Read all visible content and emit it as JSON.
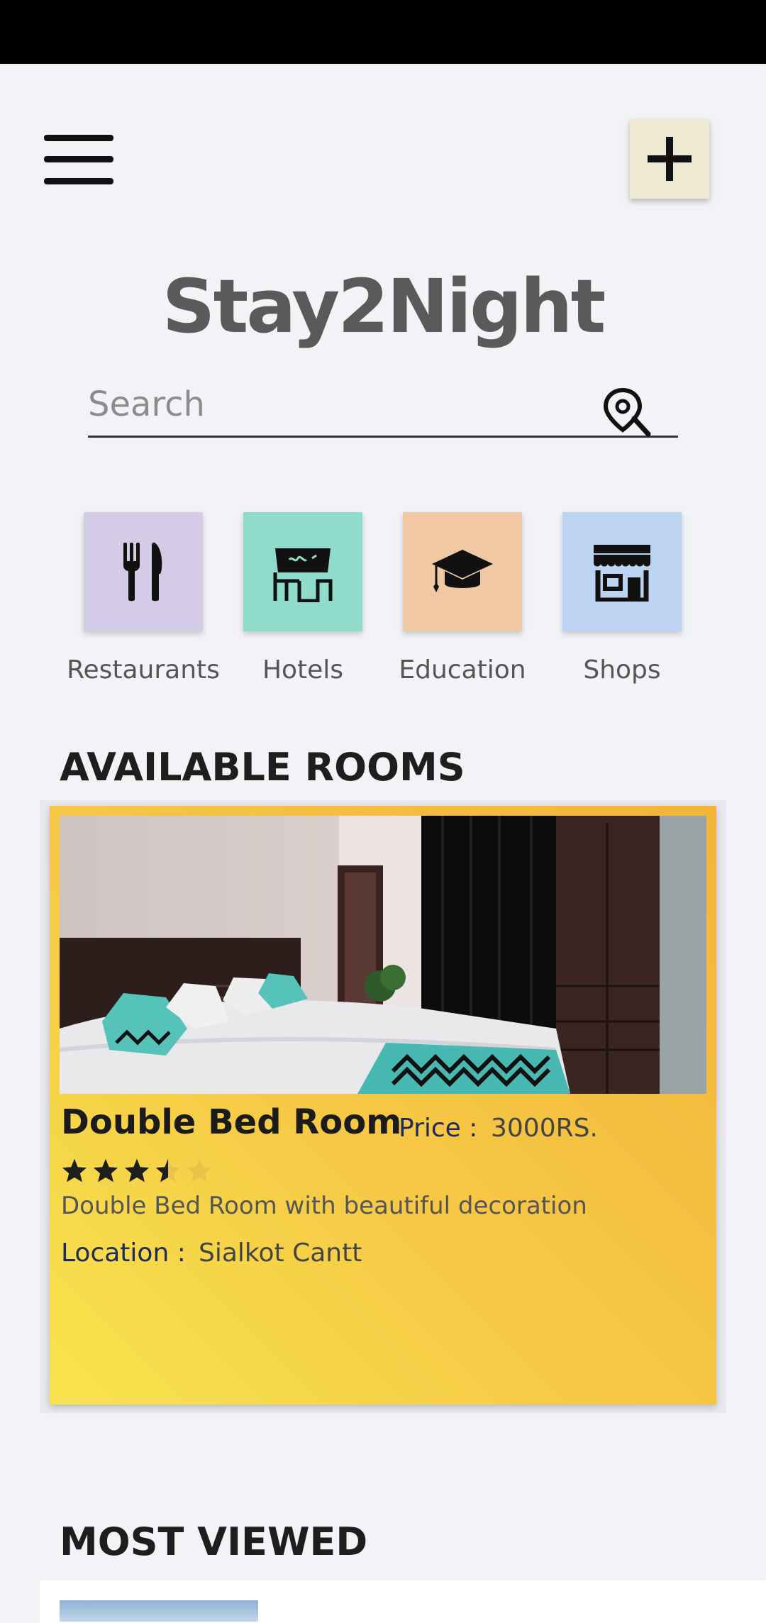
{
  "header": {
    "menu_icon": "hamburger-menu-icon",
    "add_icon": "plus-icon"
  },
  "app": {
    "title": "Stay2Night"
  },
  "search": {
    "placeholder": "Search",
    "icon": "location-search-icon"
  },
  "categories": [
    {
      "label": "Restaurants",
      "icon": "fork-knife-icon",
      "color": "#d4cce6"
    },
    {
      "label": "Hotels",
      "icon": "hotel-sign-icon",
      "color": "#8fdccd"
    },
    {
      "label": "Education",
      "icon": "graduation-cap-icon",
      "color": "#f0c8a3"
    },
    {
      "label": "Shops",
      "icon": "storefront-icon",
      "color": "#bcd4f2"
    }
  ],
  "available_rooms": {
    "section_title": "AVAILABLE ROOMS",
    "rooms": [
      {
        "name": "Double Bed Room",
        "price_label": "Price :",
        "price": "3000RS.",
        "rating": 3.5,
        "rating_max": 5,
        "description": "Double Bed Room with beautiful decoration",
        "location_label": "Location :",
        "location": "Sialkot Cantt"
      }
    ]
  },
  "most_viewed": {
    "section_title": "MOST VIEWED"
  },
  "colors": {
    "card_gradient_start": "#f7e44d",
    "card_gradient_end": "#f3b43a",
    "status_bar": "#000000"
  }
}
